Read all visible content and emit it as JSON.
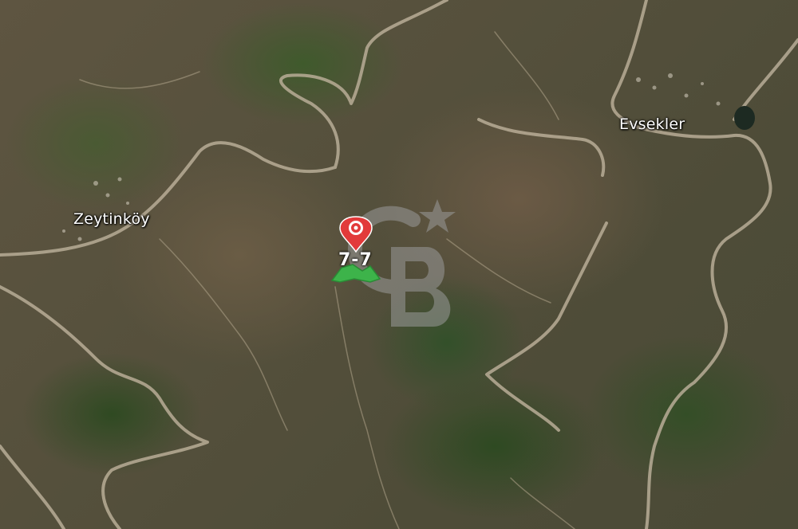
{
  "map": {
    "type": "satellite",
    "places": {
      "zeytinkoy": "Zeytinköy",
      "evsekler": "Evsekler"
    },
    "marker": {
      "label": "7-7",
      "icon": "location-pin-icon",
      "color": "#e23a3a"
    },
    "parcel": {
      "color": "#3db34a"
    },
    "watermark": {
      "icon": "watermark-logo"
    }
  }
}
